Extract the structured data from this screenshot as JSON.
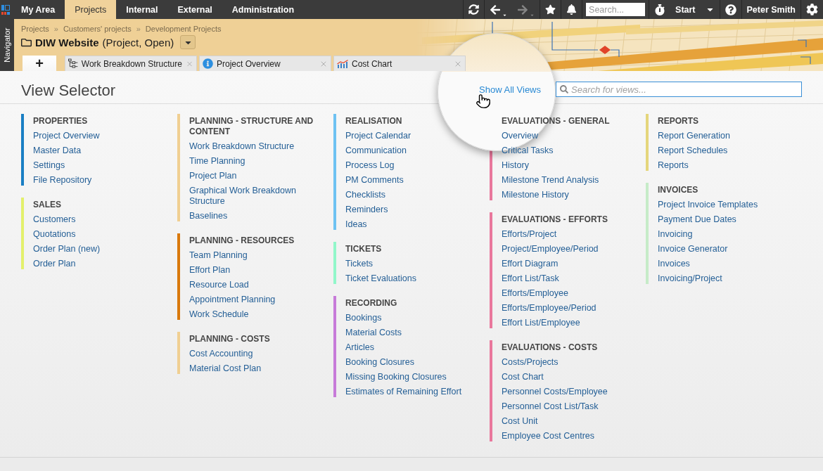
{
  "top_bar": {
    "nav_tabs": [
      {
        "label": "My Area",
        "selected": false
      },
      {
        "label": "Projects",
        "selected": true
      },
      {
        "label": "Internal",
        "selected": false
      },
      {
        "label": "External",
        "selected": false
      },
      {
        "label": "Administration",
        "selected": false
      }
    ],
    "history": [
      {
        "kind": "back",
        "disabled": false
      },
      {
        "kind": "forward",
        "disabled": true
      }
    ],
    "search": {
      "placeholder": "Search..."
    },
    "start": {
      "label": "Start"
    },
    "user": {
      "name": "Peter Smith"
    }
  },
  "navigator": {
    "label": "Navigator"
  },
  "header": {
    "breadcrumb": [
      {
        "kind": "link",
        "text": "Projects"
      },
      {
        "kind": "separator",
        "text": "»"
      },
      {
        "kind": "link",
        "text": "Customers' projects"
      },
      {
        "kind": "separator",
        "text": "»"
      },
      {
        "kind": "link",
        "text": "Development Projects"
      }
    ],
    "title": "DIW Website",
    "subtitle": "(Project, Open)"
  },
  "tabs": [
    {
      "kind": "add",
      "label": "+",
      "selected": true
    },
    {
      "kind": "structure",
      "label": "Work Breakdown Structure",
      "selected": false
    },
    {
      "kind": "info",
      "label": "Project Overview",
      "selected": false
    },
    {
      "kind": "chart",
      "label": "Cost Chart",
      "selected": false
    }
  ],
  "view_selector": {
    "title": "View Selector",
    "show_all": "Show All Views",
    "search": {
      "placeholder": "Search for views..."
    },
    "columns": [
      {
        "groups": [
          {
            "title": "PROPERTIES",
            "color": "#1a7fc4",
            "items": [
              "Project Overview",
              "Master Data",
              "Settings",
              "File Repository"
            ]
          },
          {
            "title": "SALES",
            "color": "#e3f06c",
            "items": [
              "Customers",
              "Quotations",
              "Order Plan (new)",
              "Order Plan"
            ]
          }
        ]
      },
      {
        "groups": [
          {
            "title": "PLANNING - STRUCTURE AND CONTENT",
            "color": "#f0cf92",
            "items": [
              "Work Breakdown Structure",
              "Time Planning",
              "Project Plan",
              "Graphical Work Breakdown Structure",
              "Baselines"
            ]
          },
          {
            "title": "PLANNING - RESOURCES",
            "color": "#d9790c",
            "items": [
              "Team Planning",
              "Effort Plan",
              "Resource Load",
              "Appointment Planning",
              "Work Schedule"
            ]
          },
          {
            "title": "PLANNING - COSTS",
            "color": "#f0cf92",
            "items": [
              "Cost Accounting",
              "Material Cost Plan"
            ]
          }
        ]
      },
      {
        "groups": [
          {
            "title": "REALISATION",
            "color": "#6ec2f2",
            "items": [
              "Project Calendar",
              "Communication",
              "Process Log",
              "PM Comments",
              "Checklists",
              "Reminders",
              "Ideas"
            ]
          },
          {
            "title": "TICKETS",
            "color": "#92f7ca",
            "items": [
              "Tickets",
              "Ticket Evaluations"
            ]
          },
          {
            "title": "RECORDING",
            "color": "#c77bd9",
            "items": [
              "Bookings",
              "Material Costs",
              "Articles",
              "Booking Closures",
              "Missing Booking Closures",
              "Estimates of Remaining Effort"
            ]
          }
        ]
      },
      {
        "groups": [
          {
            "title": "EVALUATIONS - GENERAL",
            "color": "#e9779c",
            "items": [
              "Overview",
              "Critical Tasks",
              "History",
              "Milestone Trend Analysis",
              "Milestone History"
            ]
          },
          {
            "title": "EVALUATIONS - EFFORTS",
            "color": "#e9779c",
            "items": [
              "Efforts/Project",
              "Project/Employee/Period",
              "Effort Diagram",
              "Effort List/Task",
              "Efforts/Employee",
              "Efforts/Employee/Period",
              "Effort List/Employee"
            ]
          },
          {
            "title": "EVALUATIONS - COSTS",
            "color": "#e9779c",
            "items": [
              "Costs/Projects",
              "Cost Chart",
              "Personnel Costs/Employee",
              "Personnel Cost List/Task",
              "Cost Unit",
              "Employee Cost Centres"
            ]
          }
        ]
      },
      {
        "groups": [
          {
            "title": "REPORTS",
            "color": "#e5d67c",
            "items": [
              "Report Generation",
              "Report Schedules",
              "Reports"
            ]
          },
          {
            "title": "INVOICES",
            "color": "#c6ebc8",
            "items": [
              "Project Invoice Templates",
              "Payment Due Dates",
              "Invoicing",
              "Invoice Generator",
              "Invoices",
              "Invoicing/Project"
            ]
          }
        ]
      }
    ]
  }
}
